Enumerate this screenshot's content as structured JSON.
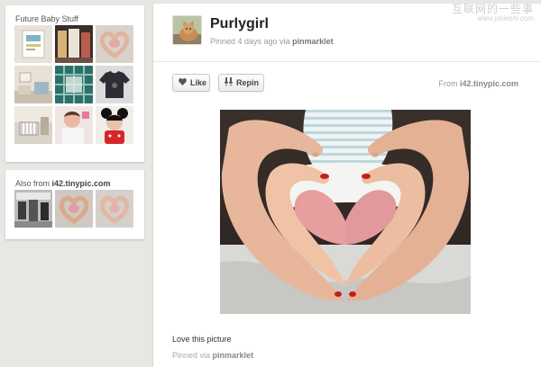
{
  "board": {
    "title": "Future Baby Stuff",
    "thumbnails": [
      {
        "icon": "baby-poster-thumb"
      },
      {
        "icon": "baby-clothes-thumb"
      },
      {
        "icon": "heart-hands-thumb"
      },
      {
        "icon": "nursery-room-thumb"
      },
      {
        "icon": "baby-blanket-thumb"
      },
      {
        "icon": "onesie-thumb"
      },
      {
        "icon": "nursery-crib-thumb"
      },
      {
        "icon": "baby-photo-thumb"
      },
      {
        "icon": "minnie-baby-thumb"
      }
    ]
  },
  "source": {
    "label": "Also from",
    "domain": "i42.tinypic.com",
    "thumbnails": [
      {
        "icon": "bw-photo-thumb"
      },
      {
        "icon": "heart-hands-thumb"
      },
      {
        "icon": "heart-hands-thumb"
      }
    ]
  },
  "pin": {
    "pinner_name": "Purlygirl",
    "pinned_prefix": "Pinned 4 days ago via",
    "pinned_via": "pinmarklet",
    "like_label": "Like",
    "repin_label": "Repin",
    "from_prefix": "From",
    "from_domain": "i42.tinypic.com",
    "description": "Love this picture",
    "footer_prefix": "Pinned via",
    "footer_via": "pinmarklet"
  },
  "watermark": {
    "line1": "互联网的一些事",
    "line2": "www.yixieshi.com"
  },
  "colors": {
    "background": "#e9e7e4",
    "nail_red": "#c21e1e"
  }
}
